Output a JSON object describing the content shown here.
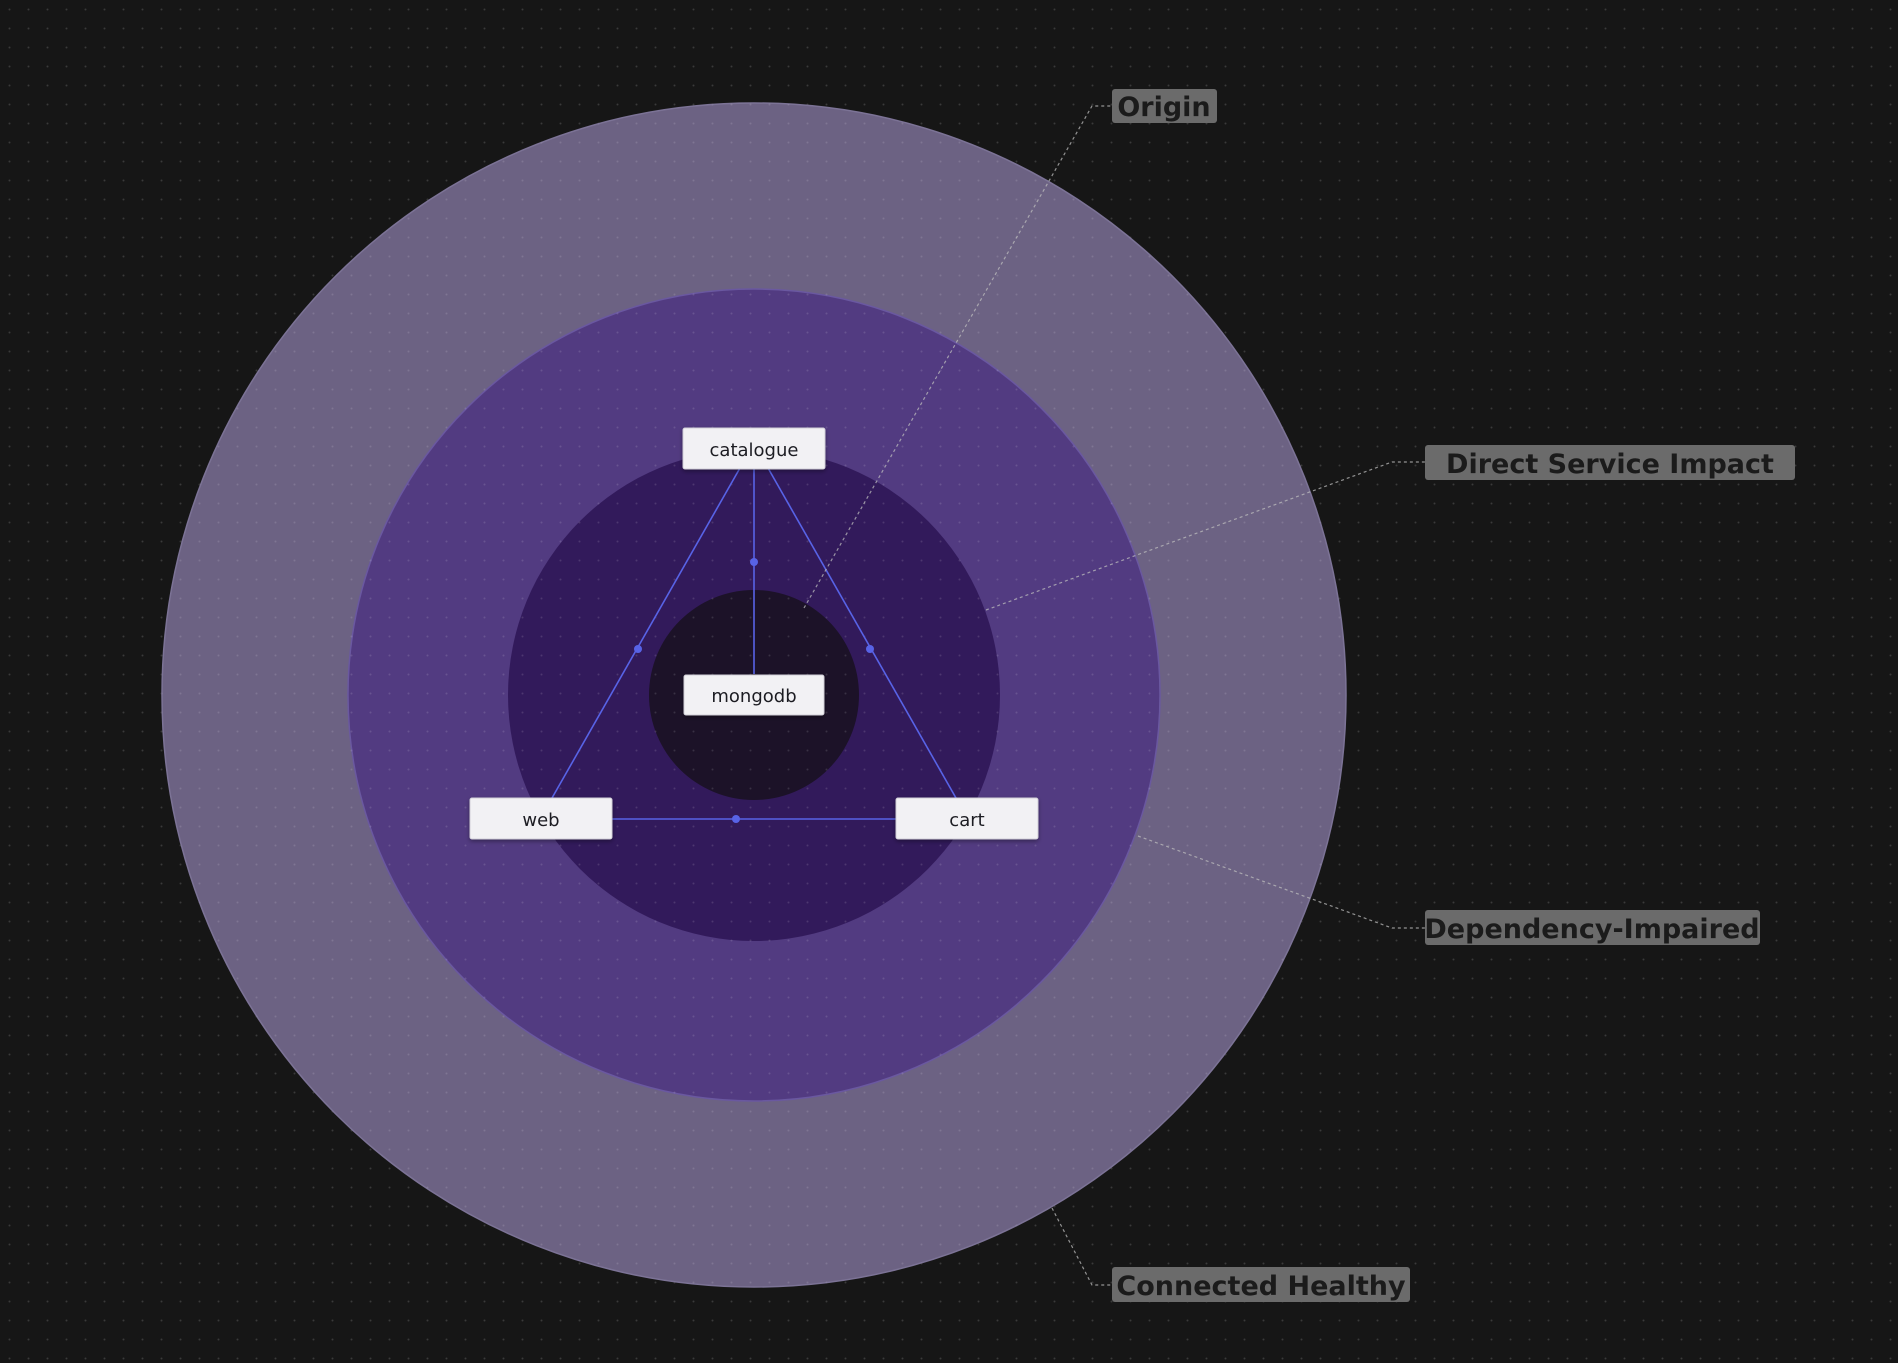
{
  "colors": {
    "background": "#161616",
    "ring_connected_healthy": "#6c6283",
    "ring_dependency_impaired": "#523b81",
    "ring_direct_service_impact": "#321a5b",
    "ring_origin": "#1c1228",
    "edge": "#5863e6",
    "node_fill": "#f2f1f4",
    "label_fill": "#6b6b6b"
  },
  "zones": {
    "origin": "Origin",
    "direct_service_impact": "Direct Service Impact",
    "dependency_impaired": "Dependency-Impaired",
    "connected_healthy": "Connected Healthy"
  },
  "nodes": {
    "catalogue": "catalogue",
    "mongodb": "mongodb",
    "web": "web",
    "cart": "cart"
  }
}
